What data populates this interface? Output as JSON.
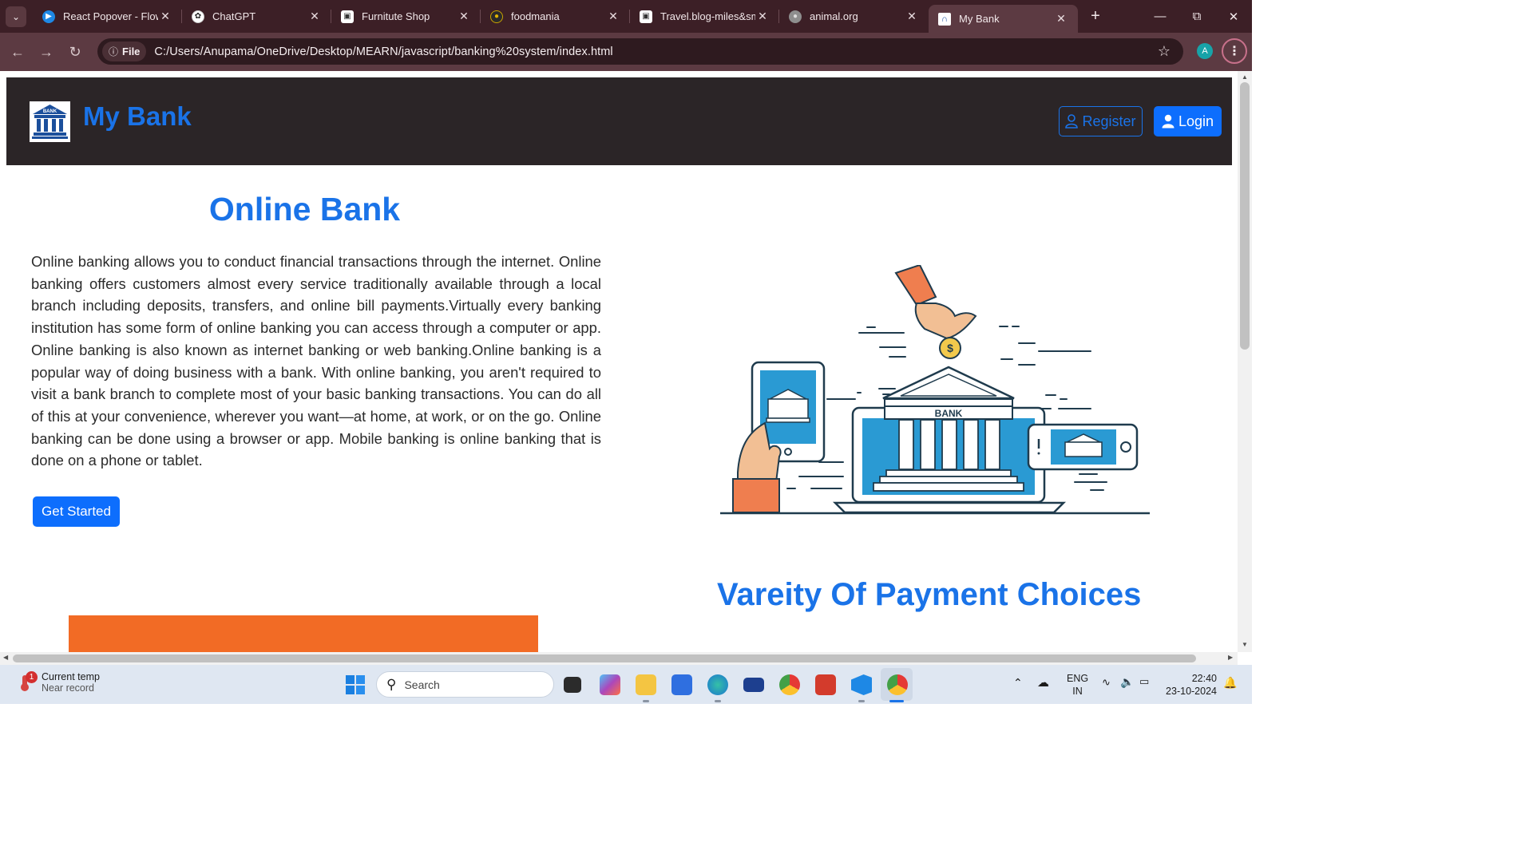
{
  "browser": {
    "tabs": [
      {
        "title": "React Popover - Flow",
        "icon": "react-flowbite-favicon",
        "color": "#1e88e5"
      },
      {
        "title": "ChatGPT",
        "icon": "chatgpt-favicon",
        "color": "#ffffff"
      },
      {
        "title": "Furnitute Shop",
        "icon": "page-favicon",
        "color": "#ffffff"
      },
      {
        "title": "foodmania",
        "icon": "food-favicon",
        "color": "#c9a300"
      },
      {
        "title": "Travel.blog-miles&sm",
        "icon": "page-favicon",
        "color": "#ffffff"
      },
      {
        "title": "animal.org",
        "icon": "globe-favicon",
        "color": "#9e9e9e"
      },
      {
        "title": "My Bank",
        "icon": "bank-favicon",
        "color": "#ffffff",
        "active": true
      }
    ],
    "address": {
      "chip": "File",
      "url": "C:/Users/Anupama/OneDrive/Desktop/MEARN/javascript/banking%20system/index.html"
    },
    "profile_initial": "A"
  },
  "page": {
    "brand": "My Bank",
    "logo_text": "BANK",
    "nav": {
      "register": "Register",
      "login": "Login"
    },
    "hero": {
      "title": "Online Bank",
      "text": "Online banking allows you to conduct financial transactions through the internet. Online banking offers customers almost every service traditionally available through a local branch including deposits, transfers, and online bill payments.Virtually every banking institution has some form of online banking you can access through a computer or app. Online banking is also known as internet banking or web banking.Online banking is a popular way of doing business with a bank. With online banking, you aren't required to visit a bank branch to complete most of your basic banking transactions. You can do all of this at your convenience, wherever you want—at home, at work, or on the go. Online banking can be done using a browser or app. Mobile banking is online banking that is done on a phone or tablet.",
      "cta": "Get Started"
    },
    "illustration": {
      "sign": "BANK",
      "coin": "$"
    },
    "section2_title": "Vareity Of Payment Choices",
    "colors": {
      "accent": "#1a73e8",
      "header_bg": "#2b2527",
      "button": "#0d6efd",
      "orange": "#f26b25"
    }
  },
  "taskbar": {
    "weather": {
      "line1": "Current temp",
      "line2": "Near record",
      "badge": "1"
    },
    "search_placeholder": "Search",
    "lang": {
      "line1": "ENG",
      "line2": "IN"
    },
    "time": "22:40",
    "date": "23-10-2024"
  }
}
